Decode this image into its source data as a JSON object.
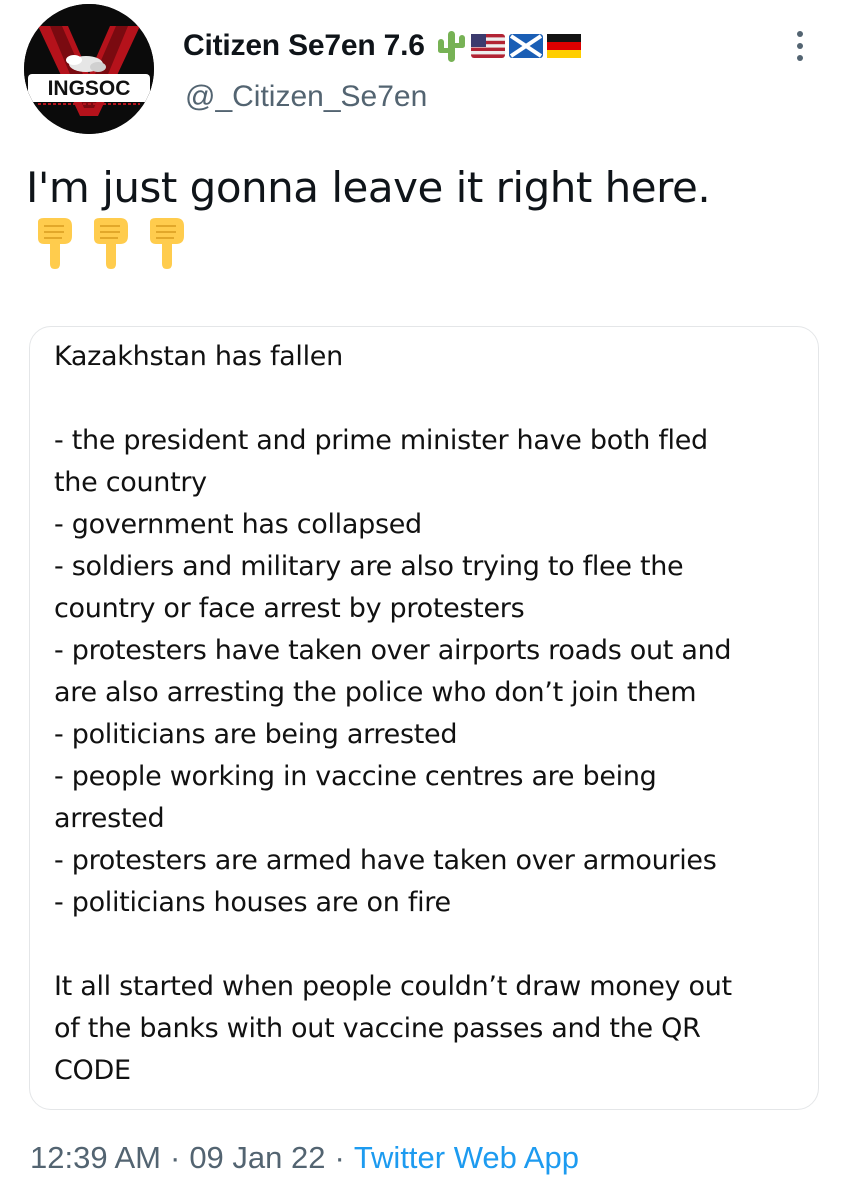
{
  "author": {
    "display_name": "Citizen Se7en 7.6",
    "handle": "@_Citizen_Se7en",
    "avatar_text": "INGSOC",
    "badges": [
      "cactus-icon",
      "us-flag-icon",
      "scotland-flag-icon",
      "germany-flag-icon"
    ]
  },
  "tweet": {
    "text": "I'm just gonna leave it right here.",
    "emojis": [
      "pointing-down-icon",
      "pointing-down-icon",
      "pointing-down-icon"
    ]
  },
  "card": {
    "title": "Kazakhstan has fallen",
    "lines": [
      "- the president and prime minister have both fled",
      "the country",
      "- government has collapsed",
      "- soldiers and military are also trying to flee the",
      "country or face arrest by protesters",
      "- protesters have taken over airports roads out and",
      "are also arresting the police who don’t join them",
      "- politicians are being arrested",
      "- people working in vaccine centres are being",
      "arrested",
      "- protesters are armed have taken over armouries",
      "-  politicians houses are on fire"
    ],
    "footer_lines": [
      "It all started when people couldn’t draw money out",
      "of the banks with out vaccine passes and the QR",
      "CODE"
    ]
  },
  "meta": {
    "time": "12:39 AM",
    "separator": "·",
    "date": "09 Jan 22",
    "source": "Twitter Web App"
  },
  "colors": {
    "text": "#0f1419",
    "muted": "#536471",
    "link": "#1d9bf0",
    "card_border": "#e4e6e8"
  }
}
